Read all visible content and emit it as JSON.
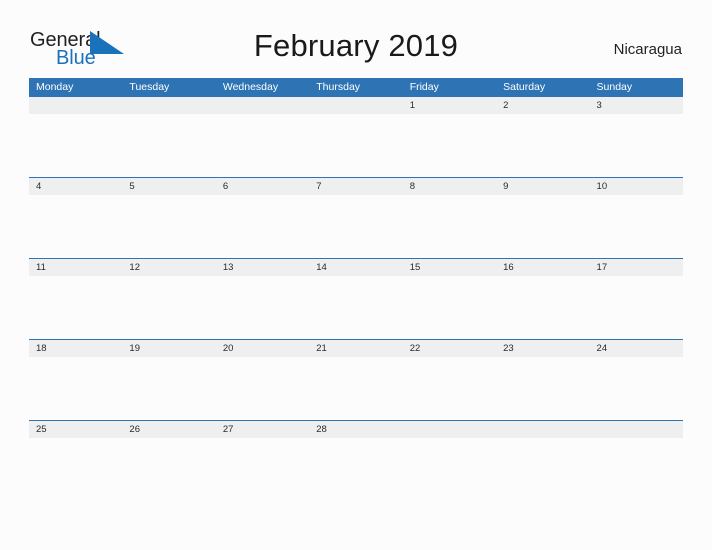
{
  "brand": {
    "name_part1": "General",
    "name_part2": "Blue",
    "accent_color": "#1a72bb",
    "flag_icon": "flag-triangle-icon"
  },
  "header": {
    "title": "February 2019",
    "region": "Nicaragua"
  },
  "calendar": {
    "header_bg": "#2e74b5",
    "date_strip_bg": "#efefef",
    "weekday_headers": [
      "Monday",
      "Tuesday",
      "Wednesday",
      "Thursday",
      "Friday",
      "Saturday",
      "Sunday"
    ],
    "weeks": [
      [
        "",
        "",
        "",
        "",
        "1",
        "2",
        "3"
      ],
      [
        "4",
        "5",
        "6",
        "7",
        "8",
        "9",
        "10"
      ],
      [
        "11",
        "12",
        "13",
        "14",
        "15",
        "16",
        "17"
      ],
      [
        "18",
        "19",
        "20",
        "21",
        "22",
        "23",
        "24"
      ],
      [
        "25",
        "26",
        "27",
        "28",
        "",
        "",
        ""
      ]
    ]
  }
}
